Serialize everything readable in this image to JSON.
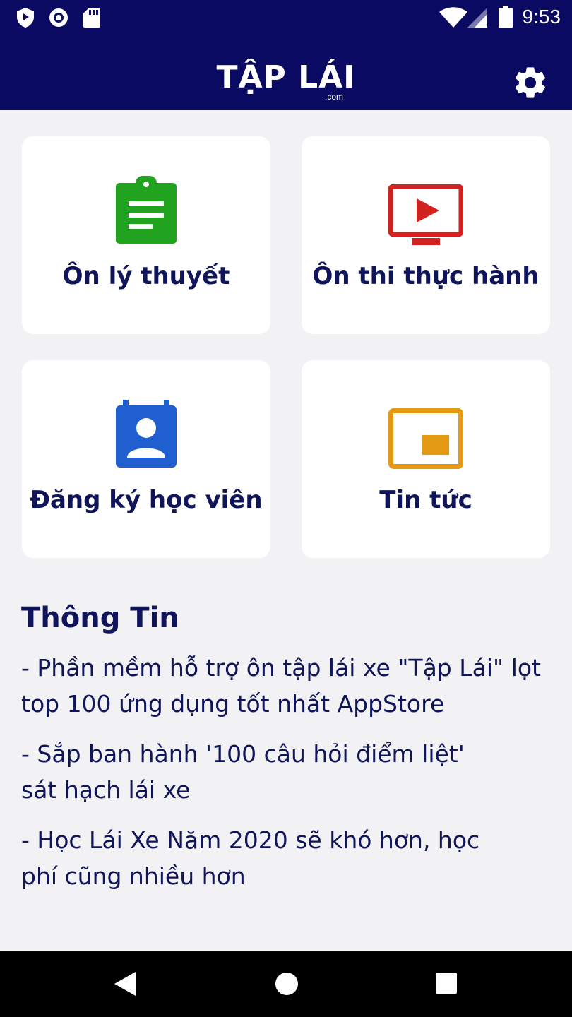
{
  "status_bar": {
    "time": "9:53",
    "left_icons": [
      "shield-icon",
      "record-icon",
      "sd-card-icon"
    ],
    "right_icons": [
      "wifi-icon",
      "signal-icon",
      "battery-icon"
    ]
  },
  "app_bar": {
    "logo_main": "TẬP LÁI",
    "logo_suffix": ".com",
    "settings_icon": "gear-icon",
    "background_color": "#0a0a63"
  },
  "menu": [
    {
      "label": "Ôn lý thuyết",
      "icon": "clipboard-icon",
      "color": "#22a31f"
    },
    {
      "label": "Ôn thi thực hành",
      "icon": "tv-play-icon",
      "color": "#d1221f"
    },
    {
      "label": "Đăng ký học viên",
      "icon": "contact-calendar-icon",
      "color": "#1f5fcf"
    },
    {
      "label": "Tin tức",
      "icon": "picture-in-picture-icon",
      "color": "#e59a13"
    }
  ],
  "info": {
    "title": "Thông Tin",
    "items": [
      "- Phần mềm hỗ trợ ôn tập lái xe  \"Tập Lái\" lọt top 100 ứng dụng tốt nhất AppStore",
      "- Sắp ban hành '100 câu hỏi điểm liệt' sát hạch lái xe",
      "- Học Lái Xe Năm 2020 sẽ khó hơn, học phí cũng nhiều hơn"
    ]
  },
  "nav_bar": {
    "buttons": [
      "back-icon",
      "home-icon",
      "recents-icon"
    ]
  }
}
